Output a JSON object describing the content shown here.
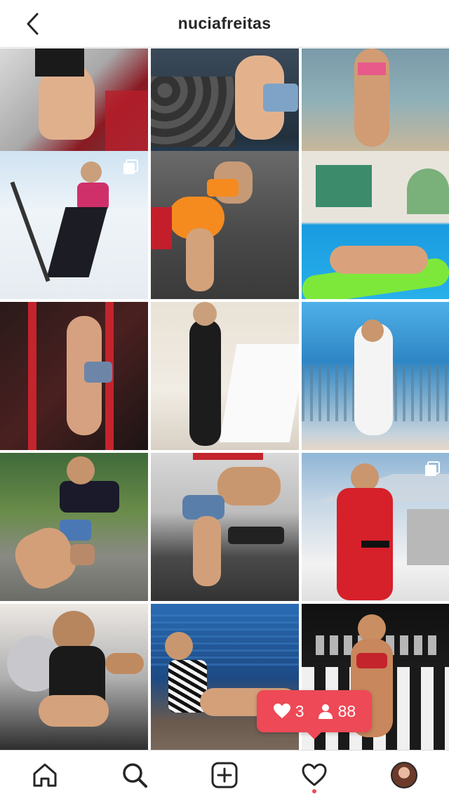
{
  "header": {
    "username": "nuciafreitas"
  },
  "icons": {
    "back": "chevron-left-icon",
    "home": "home-icon",
    "search": "search-icon",
    "add": "add-post-icon",
    "activity": "heart-icon",
    "profile": "profile-avatar"
  },
  "activity_popup": {
    "likes": "3",
    "followers": "88"
  },
  "colors": {
    "accent": "#ed4956",
    "text": "#262626",
    "border": "#dbdbdb"
  },
  "grid": {
    "tiles": [
      {
        "id": "gym-machine-pose",
        "multi": false
      },
      {
        "id": "dumbbell-rack",
        "multi": false
      },
      {
        "id": "beach-shore",
        "multi": false
      },
      {
        "id": "ski-slope",
        "multi": true
      },
      {
        "id": "cable-machine",
        "multi": false
      },
      {
        "id": "pool-float",
        "multi": false
      },
      {
        "id": "red-gym-rack",
        "multi": false
      },
      {
        "id": "dining-table",
        "multi": false
      },
      {
        "id": "seaside-balcony",
        "multi": false
      },
      {
        "id": "park-outfit",
        "multi": false
      },
      {
        "id": "gym-dumbbells",
        "multi": false
      },
      {
        "id": "red-ski-suit",
        "multi": true
      },
      {
        "id": "fitness-ball",
        "multi": false
      },
      {
        "id": "zebra-swimsuit",
        "multi": false
      },
      {
        "id": "competition-stage",
        "multi": false
      }
    ]
  }
}
